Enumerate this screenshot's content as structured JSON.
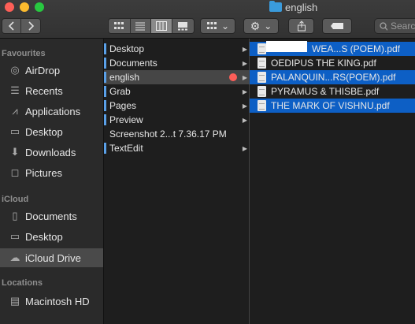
{
  "window": {
    "title": "english"
  },
  "toolbar": {
    "view_icons": [
      "icon-view-icon",
      "list-view-icon",
      "column-view-icon",
      "gallery-view-icon"
    ],
    "group_chevron": "⌄",
    "action_chevron": "⌄",
    "search_placeholder": "Search"
  },
  "sidebar": {
    "favourites_title": "Favourites",
    "favourites": [
      {
        "label": "AirDrop",
        "icon": "◎"
      },
      {
        "label": "Recents",
        "icon": "☰"
      },
      {
        "label": "Applications",
        "icon": "⩘"
      },
      {
        "label": "Desktop",
        "icon": "▭"
      },
      {
        "label": "Downloads",
        "icon": "⬇"
      },
      {
        "label": "Pictures",
        "icon": "◻"
      }
    ],
    "icloud_title": "iCloud",
    "icloud": [
      {
        "label": "Documents",
        "icon": "▯"
      },
      {
        "label": "Desktop",
        "icon": "▭"
      },
      {
        "label": "iCloud Drive",
        "icon": "☁"
      }
    ],
    "locations_title": "Locations",
    "locations": [
      {
        "label": "Macintosh HD",
        "icon": "▤"
      }
    ]
  },
  "column1": [
    {
      "label": "Desktop"
    },
    {
      "label": "Documents"
    },
    {
      "label": "english"
    },
    {
      "label": "Grab"
    },
    {
      "label": "Pages"
    },
    {
      "label": "Preview"
    },
    {
      "label": "Screenshot 2...t 7.36.17 PM"
    },
    {
      "label": "TextEdit"
    }
  ],
  "column2": [
    {
      "label": "WEA...S (POEM).pdf"
    },
    {
      "label": "OEDIPUS THE KING.pdf"
    },
    {
      "label": "PALANQUIN...RS(POEM).pdf"
    },
    {
      "label": "PYRAMUS & THISBE.pdf"
    },
    {
      "label": "THE MARK OF VISHNU.pdf"
    }
  ],
  "colors": {
    "selection_blue": "#0d5fc5",
    "tag_red": "#fd5e58",
    "folder_blue": "#3a9bdc"
  }
}
